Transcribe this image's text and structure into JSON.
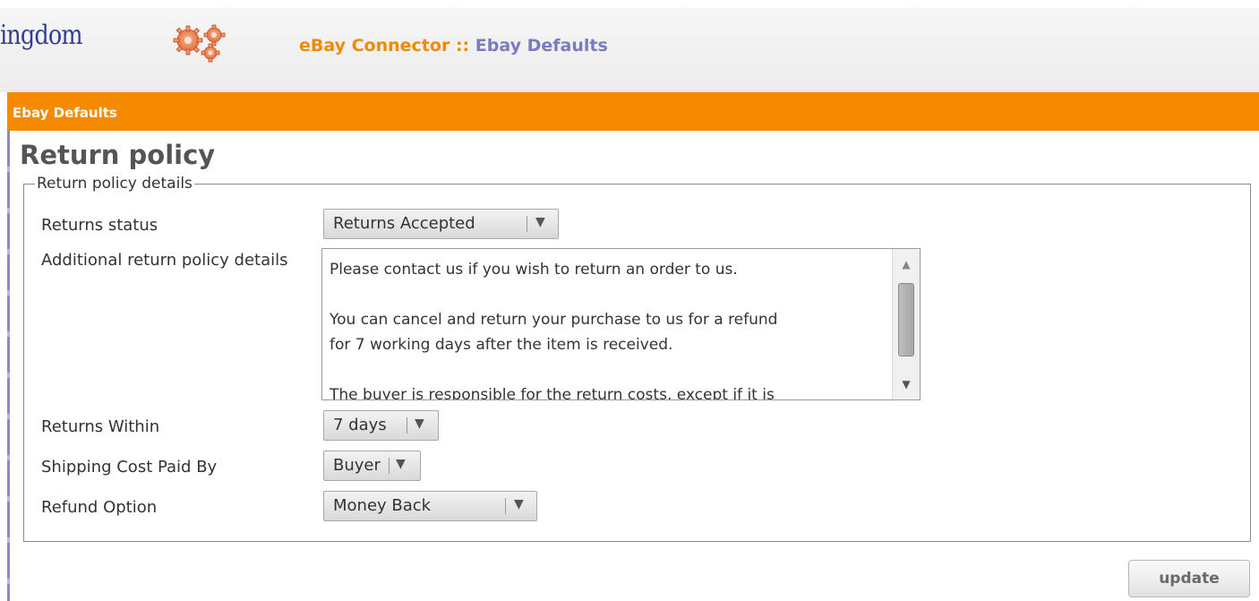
{
  "header": {
    "logo_text": "ingdom",
    "title_app": "eBay Connector",
    "title_separator": "::",
    "title_page": "Ebay Defaults"
  },
  "section_bar": {
    "label": "Ebay Defaults"
  },
  "page": {
    "title": "Return policy"
  },
  "form": {
    "legend": "Return policy details",
    "returns_status": {
      "label": "Returns status",
      "value": "Returns Accepted"
    },
    "additional_details": {
      "label": "Additional return policy details",
      "lines": [
        "Please contact us if you wish to return an order to us.",
        "",
        "You can cancel and return your purchase to us for a refund",
        "for 7 working days after the item is received.",
        "",
        "The buyer is responsible for the return costs, except if it is"
      ]
    },
    "returns_within": {
      "label": "Returns Within",
      "value": "7 days"
    },
    "shipping_cost_paid_by": {
      "label": "Shipping Cost Paid By",
      "value": "Buyer"
    },
    "refund_option": {
      "label": "Refund Option",
      "value": "Money Back"
    },
    "update_button": "update"
  },
  "colors": {
    "orange": "#f58a00",
    "title_orange": "#f08a00",
    "title_purple": "#7b7bbf"
  },
  "icons": {
    "gears": "gears-icon",
    "dropdown": "triangle-down-icon",
    "scroll_up": "triangle-up-icon",
    "scroll_down": "triangle-down-icon"
  }
}
